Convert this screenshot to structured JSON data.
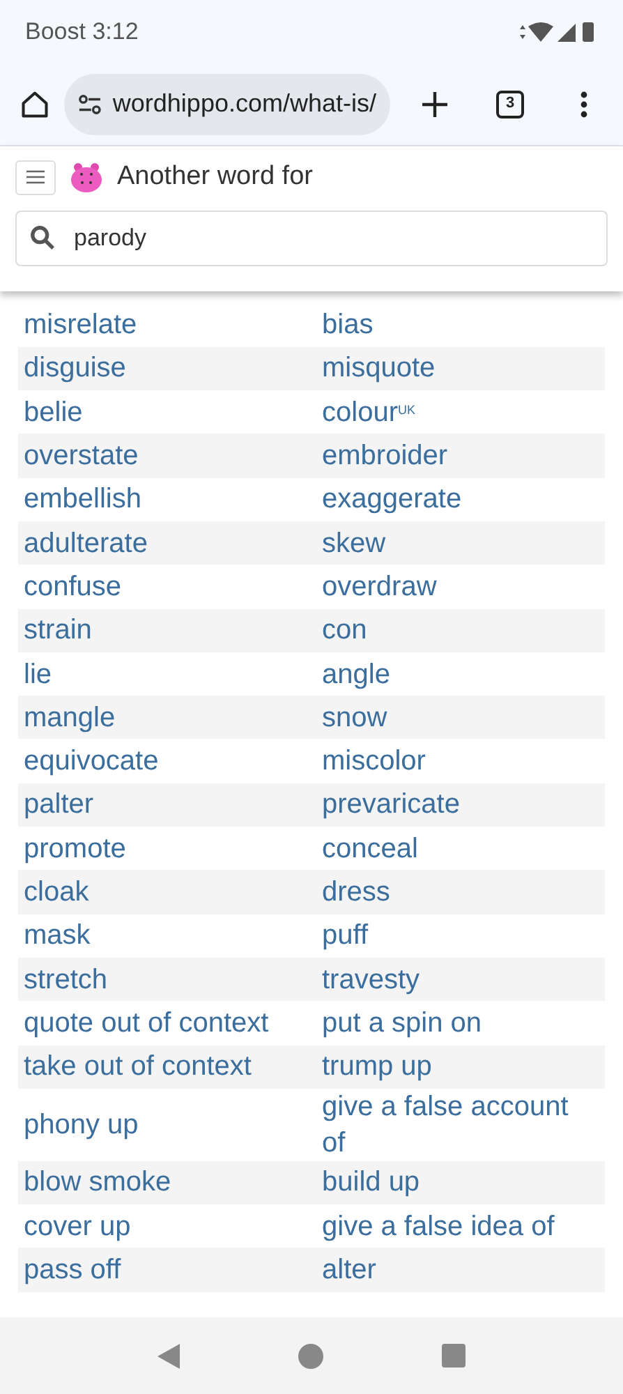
{
  "status_bar": {
    "carrier_time": "Boost 3:12"
  },
  "browser": {
    "url": "wordhippo.com/what-is/",
    "tab_count": "3"
  },
  "site_header": {
    "title": "Another word for"
  },
  "search": {
    "value": "parody"
  },
  "synonyms": [
    [
      "misrelate",
      "bias"
    ],
    [
      "disguise",
      "misquote"
    ],
    [
      "belie",
      "colour$^{UK}$"
    ],
    [
      "overstate",
      "embroider"
    ],
    [
      "embellish",
      "exaggerate"
    ],
    [
      "adulterate",
      "skew"
    ],
    [
      "confuse",
      "overdraw"
    ],
    [
      "strain",
      "con"
    ],
    [
      "lie",
      "angle"
    ],
    [
      "mangle",
      "snow"
    ],
    [
      "equivocate",
      "miscolor"
    ],
    [
      "palter",
      "prevaricate"
    ],
    [
      "promote",
      "conceal"
    ],
    [
      "cloak",
      "dress"
    ],
    [
      "mask",
      "puff"
    ],
    [
      "stretch",
      "travesty"
    ],
    [
      "quote out of context",
      "put a spin on"
    ],
    [
      "take out of context",
      "trump up"
    ],
    [
      "phony up",
      "give a false account of"
    ],
    [
      "blow smoke",
      "build up"
    ],
    [
      "cover up",
      "give a false idea of"
    ],
    [
      "pass off",
      "alter"
    ]
  ]
}
